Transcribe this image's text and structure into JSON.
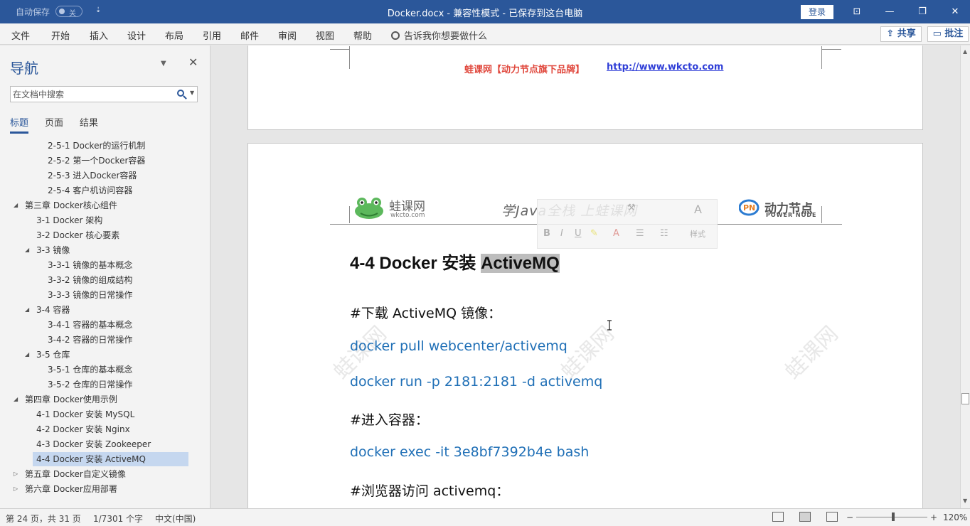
{
  "titlebar": {
    "autosave_label": "自动保存",
    "autosave_state": "关",
    "qa_dropdown": "⇣",
    "doc_title": "Docker.docx  -  兼容性模式 - 已保存到这台电脑",
    "login": "登录",
    "btn_ribbon": "⊡",
    "btn_minimize": "—",
    "btn_restore": "❐",
    "btn_close": "✕"
  },
  "menu": {
    "items": [
      "文件",
      "开始",
      "插入",
      "设计",
      "布局",
      "引用",
      "邮件",
      "审阅",
      "视图",
      "帮助"
    ],
    "tellme": "告诉我你想要做什么",
    "share": "⇪ 共享",
    "comments": "▭ 批注"
  },
  "nav": {
    "title": "导航",
    "dropdown": "▼",
    "close": "✕",
    "search_placeholder": "在文档中搜索",
    "search_dropdown": "▼",
    "tabs": [
      "标题",
      "页面",
      "结果"
    ],
    "tree": [
      {
        "label": "2-5-1 Docker的运行机制",
        "level": 3
      },
      {
        "label": "2-5-2 第一个Docker容器",
        "level": 3
      },
      {
        "label": "2-5-3 进入Docker容器",
        "level": 3
      },
      {
        "label": "2-5-4 客户机访问容器",
        "level": 3
      },
      {
        "label": "第三章 Docker核心组件",
        "level": 1,
        "toggle": "◢"
      },
      {
        "label": "3-1 Docker 架构",
        "level": 2
      },
      {
        "label": "3-2 Docker 核心要素",
        "level": 2
      },
      {
        "label": "3-3 镜像",
        "level": 2,
        "toggle": "◢"
      },
      {
        "label": "3-3-1 镜像的基本概念",
        "level": 3
      },
      {
        "label": "3-3-2 镜像的组成结构",
        "level": 3
      },
      {
        "label": "3-3-3 镜像的日常操作",
        "level": 3
      },
      {
        "label": "3-4 容器",
        "level": 2,
        "toggle": "◢"
      },
      {
        "label": "3-4-1 容器的基本概念",
        "level": 3
      },
      {
        "label": "3-4-2 容器的日常操作",
        "level": 3
      },
      {
        "label": "3-5 仓库",
        "level": 2,
        "toggle": "◢"
      },
      {
        "label": "3-5-1 仓库的基本概念",
        "level": 3
      },
      {
        "label": "3-5-2 仓库的日常操作",
        "level": 3
      },
      {
        "label": "第四章 Docker使用示例",
        "level": 1,
        "toggle": "◢"
      },
      {
        "label": "4-1 Docker 安装 MySQL",
        "level": 2
      },
      {
        "label": "4-2 Docker 安装 Nginx",
        "level": 2
      },
      {
        "label": "4-3 Docker 安装 Zookeeper",
        "level": 2
      },
      {
        "label": "4-4 Docker 安装 ActiveMQ",
        "level": 2,
        "selected": true
      },
      {
        "label": "第五章 Docker自定义镜像",
        "level": 1,
        "toggle": "▷"
      },
      {
        "label": "第六章 Docker应用部署",
        "level": 1,
        "toggle": "▷"
      }
    ]
  },
  "doc": {
    "header_brand": "蛙课网【动力节点旗下品牌】",
    "header_link": "http://www.wkcto.com",
    "logo_left_name": "蛙课网",
    "logo_left_sub": "wkcto.com",
    "slogan": "学Java全栈  上蛙课网",
    "logo_right_name": "动力节点",
    "logo_right_sub": "POWER NODE",
    "watermark": "蛙课网",
    "heading_prefix": "4-4 Docker  安装  ",
    "heading_selected": "ActiveMQ",
    "lines": [
      {
        "text": "#下载 ActiveMQ 镜像：",
        "code": false
      },
      {
        "text": "docker pull webcenter/activemq",
        "code": true
      },
      {
        "text": "docker run -p 2181:2181 -d activemq",
        "code": true
      },
      {
        "text": "#进入容器：",
        "code": false
      },
      {
        "text": "docker exec -it 3e8bf7392b4e bash",
        "code": true
      },
      {
        "text": "#浏览器访问 activemq：",
        "code": false
      }
    ],
    "mini_toolbar": {
      "bold": "B",
      "italic": "I",
      "underline": "U",
      "highlight": "✎",
      "font_color": "A",
      "bullets": "☰",
      "numbering": "☷",
      "styles": "样式",
      "font_size_up": "A",
      "format_painter": "⚒"
    }
  },
  "status": {
    "page": "第 24 页，共 31 页",
    "words": "1/7301 个字",
    "lang": "中文(中国)",
    "zoom_minus": "−",
    "zoom_plus": "+",
    "zoom": "120%"
  },
  "scroll": {
    "up": "▲",
    "down": "▼"
  },
  "colors": {
    "brand": "#2b579a",
    "code": "#1f6fb6",
    "header_brand": "#e0473c",
    "link": "#2f3ed7"
  }
}
